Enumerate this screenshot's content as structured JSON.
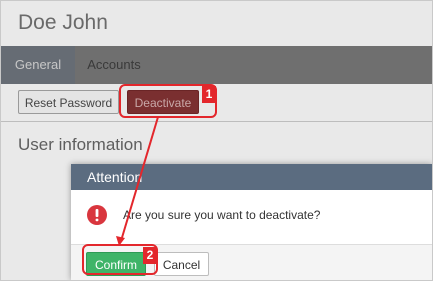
{
  "page": {
    "title": "Doe John"
  },
  "tabs": [
    {
      "label": "General",
      "active": true
    },
    {
      "label": "Accounts",
      "active": false
    }
  ],
  "toolbar": {
    "reset_password_label": "Reset Password",
    "deactivate_label": "Deactivate"
  },
  "section": {
    "title": "User information"
  },
  "dialog": {
    "title": "Attention",
    "icon": "exclamation-circle-icon",
    "message": "Are you sure you want to deactivate?",
    "confirm_label": "Confirm",
    "cancel_label": "Cancel"
  },
  "annotations": {
    "step1": "1",
    "step2": "2"
  },
  "colors": {
    "highlight": "#e3272c",
    "dialog_header": "#5b6c80",
    "confirm": "#3fb468",
    "deactivate": "#7a2f30"
  }
}
